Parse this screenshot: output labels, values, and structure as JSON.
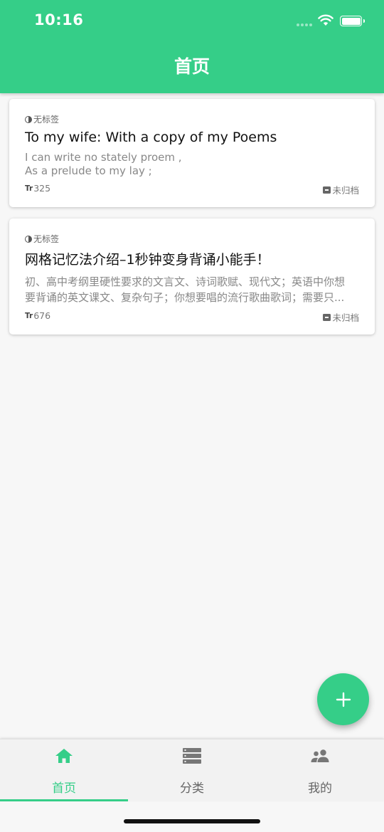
{
  "status_bar": {
    "time": "10:16"
  },
  "header": {
    "title": "首页"
  },
  "colors": {
    "accent": "#35ce88"
  },
  "notes": [
    {
      "tag": "无标签",
      "title": "To my wife: With a copy of my Poems",
      "excerpt": [
        "I  can write no stately proem ,",
        "As a prelude to my lay ;"
      ],
      "word_count": "325",
      "archive_status": "未归档"
    },
    {
      "tag": "无标签",
      "title": "网格记忆法介绍–1秒钟变身背诵小能手！",
      "excerpt": [
        "初、高中考纲里硬性要求的文言文、诗词歌赋、现代文；英语中你想",
        "要背诵的英文课文、复杂句子；你想要唱的流行歌曲歌词；需要只..."
      ],
      "word_count": "676",
      "archive_status": "未归档"
    }
  ],
  "fab": {
    "icon": "plus-icon",
    "label": "+"
  },
  "tabs": [
    {
      "label": "首页",
      "icon": "home-icon",
      "active": true
    },
    {
      "label": "分类",
      "icon": "list-icon",
      "active": false
    },
    {
      "label": "我的",
      "icon": "people-icon",
      "active": false
    }
  ]
}
